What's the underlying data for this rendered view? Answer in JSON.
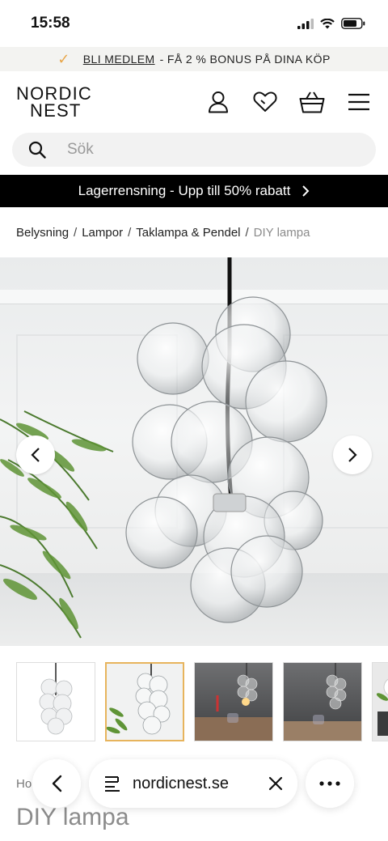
{
  "status": {
    "time": "15:58"
  },
  "promo": {
    "link_text": "BLI MEDLEM",
    "rest_text": "- FÅ 2 % BONUS PÅ DINA KÖP"
  },
  "header": {
    "logo_line1": "NORDIC",
    "logo_line2": "NEST"
  },
  "search": {
    "placeholder": "Sök"
  },
  "banner": {
    "text": "Lagerrensning - Upp till 50% rabatt"
  },
  "breadcrumb": {
    "items": [
      "Belysning",
      "Lampor",
      "Taklampa & Pendel"
    ],
    "separator": "/",
    "current": "DIY lampa"
  },
  "gallery": {
    "thumb_count": 5,
    "active_index": 1
  },
  "product": {
    "brand_partial": "Ho",
    "title": "DIY lampa"
  },
  "browser": {
    "url": "nordicnest.se"
  },
  "colors": {
    "accent": "#e7b45d",
    "promo_check": "#e8a64a",
    "banner_bg": "#000000"
  }
}
